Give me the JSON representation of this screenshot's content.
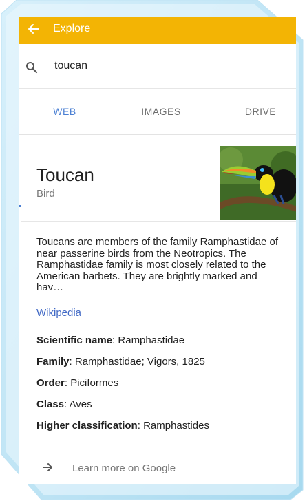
{
  "explore_bar": {
    "title": "Explore",
    "color": "#f3b404"
  },
  "search": {
    "query": "toucan"
  },
  "tabs": [
    {
      "label": "WEB",
      "active": true
    },
    {
      "label": "IMAGES",
      "active": false
    },
    {
      "label": "DRIVE",
      "active": false
    }
  ],
  "accent_color": "#4a7fd3",
  "knowledge_card": {
    "title": "Toucan",
    "subtitle": "Bird",
    "description": "Toucans are members of the family Ramphastidae of near passerine birds from the Neotropics. The Ramphastidae family is most closely related to the American barbets. They are brightly marked and hav…",
    "source_link": "Wikipedia",
    "facts": [
      {
        "key": "Scientific name",
        "value": "Ramphastidae"
      },
      {
        "key": "Family",
        "value": "Ramphastidae; Vigors, 1825"
      },
      {
        "key": "Order",
        "value": "Piciformes"
      },
      {
        "key": "Class",
        "value": "Aves"
      },
      {
        "key": "Higher classification",
        "value": "Ramphastides"
      }
    ],
    "learn_more": "Learn more on Google"
  }
}
